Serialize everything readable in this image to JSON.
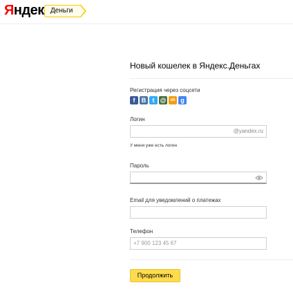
{
  "header": {
    "logo_first": "Я",
    "logo_rest": "ндекс",
    "service_tag": "Деньги"
  },
  "form": {
    "title": "Новый кошелек в Яндекс.Деньгах",
    "social_label": "Регистрация через соцсети",
    "social": [
      {
        "name": "facebook-icon",
        "glyph": "f",
        "color": "#3b5998"
      },
      {
        "name": "vk-icon",
        "glyph": "B",
        "color": "#4c75a3"
      },
      {
        "name": "twitter-icon",
        "glyph": "t",
        "color": "#33aaf3"
      },
      {
        "name": "mailru-icon",
        "glyph": "@",
        "color": "#4a6d3a"
      },
      {
        "name": "odnoklassniki-icon",
        "glyph": "ok",
        "color": "#f39c12"
      },
      {
        "name": "google-icon",
        "glyph": "g",
        "color": "#4285f4"
      }
    ],
    "login_label": "Логин",
    "login_suffix": "@yandex.ru",
    "login_value": "",
    "have_login_link": "У меня уже есть логин",
    "password_label": "Пароль",
    "password_value": "",
    "email_label": "Email для уведомлений о платежах",
    "email_value": "",
    "phone_label": "Телефон",
    "phone_placeholder": "+7 900 123 45 67",
    "submit_label": "Продолжить"
  }
}
